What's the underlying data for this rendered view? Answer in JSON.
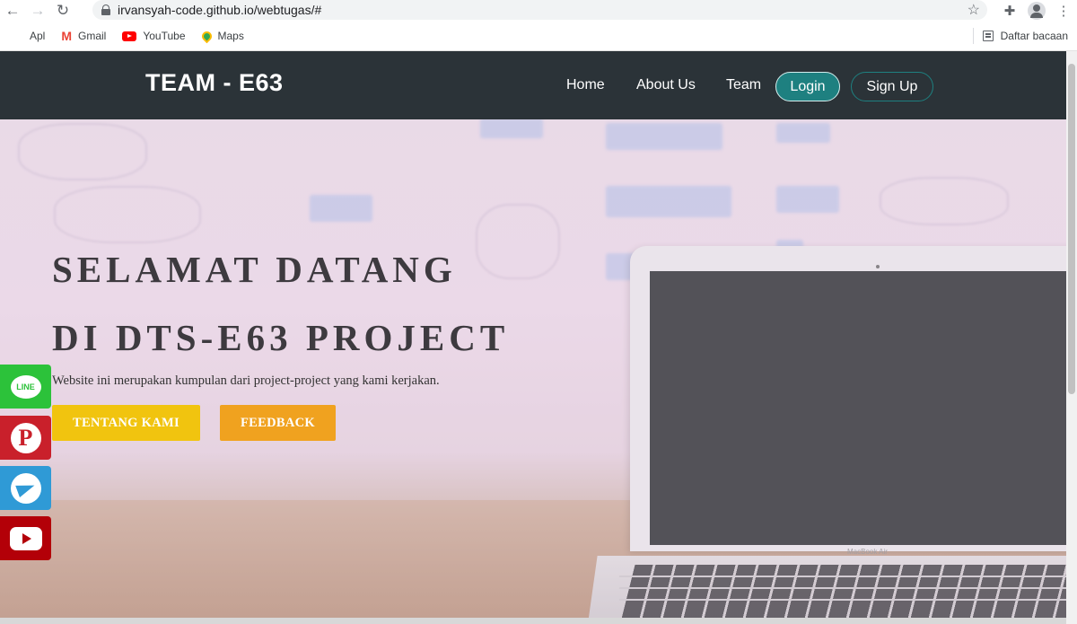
{
  "browser": {
    "url": "irvansyah-code.github.io/webtugas/#",
    "bookmarks": [
      "Apl",
      "Gmail",
      "YouTube",
      "Maps"
    ],
    "reading_list": "Daftar bacaan"
  },
  "navbar": {
    "brand": "TEAM - E63",
    "links": [
      "Home",
      "About Us",
      "Team"
    ],
    "login": "Login",
    "signup": "Sign Up",
    "bg_color": "#2b3338",
    "accent_color": "#1e8080"
  },
  "hero": {
    "title_line1": "SELAMAT DATANG",
    "title_line2": "DI DTS-E63 PROJECT",
    "subtitle": "Website ini merupakan kumpulan dari project-project yang kami kerjakan.",
    "btn_primary": "TENTANG KAMI",
    "btn_secondary": "FEEDBACK",
    "btn_primary_color": "#f1c40f",
    "btn_secondary_color": "#f0a21f"
  },
  "laptop": {
    "label": "MacBook Air"
  },
  "social": {
    "line_label": "LINE",
    "pinterest_glyph": "P",
    "icons": [
      "line-icon",
      "pinterest-icon",
      "telegram-icon",
      "youtube-icon"
    ]
  }
}
